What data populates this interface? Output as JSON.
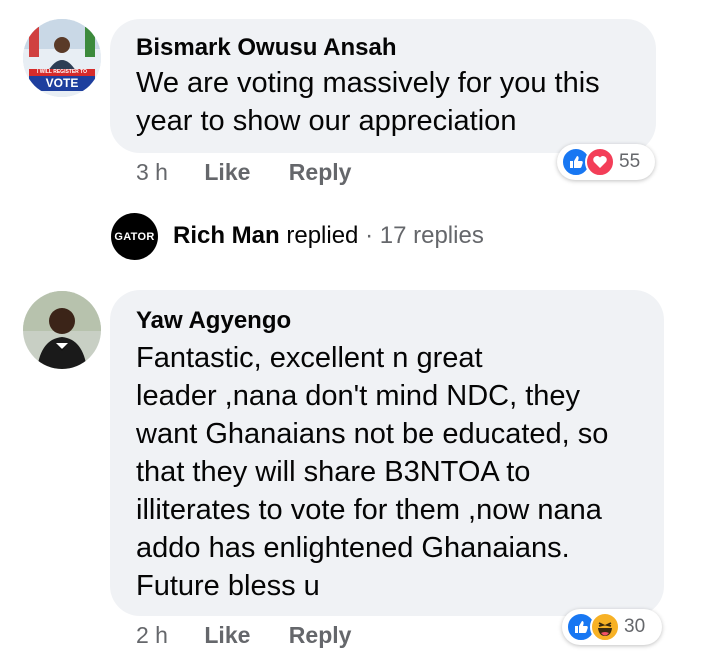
{
  "comment1": {
    "author": "Bismark Owusu Ansah",
    "text_lines": [
      "We are voting massively for you this",
      "year to show our appreciation"
    ],
    "time": "3 h",
    "like_label": "Like",
    "reply_label": "Reply",
    "reaction_count": "55",
    "reaction_icons": [
      "like-icon",
      "love-icon"
    ],
    "avatar_badge_small": "I WILL REGISTER TO",
    "avatar_badge_big": "VOTE"
  },
  "reply_thread": {
    "avatar_text": "GATOR",
    "name": "Rich Man",
    "verb": "replied",
    "separator": "·",
    "count": "17 replies"
  },
  "comment2": {
    "author": "Yaw Agyengo",
    "text_lines": [
      "Fantastic, excellent n great",
      "leader ,nana don't mind NDC, they",
      "want Ghanaians not be educated, so",
      "that they will share B3NTOA to",
      "illiterates to vote for them ,now nana",
      "addo has enlightened Ghanaians.",
      "Future bless u"
    ],
    "time": "2 h",
    "like_label": "Like",
    "reply_label": "Reply",
    "reaction_count": "30",
    "reaction_icons": [
      "like-icon",
      "haha-icon"
    ]
  },
  "colors": {
    "bubble": "#f0f2f5",
    "like_blue": "#1877f2",
    "love_red": "#f33e58",
    "haha_yellow": "#f7b125",
    "meta_gray": "#65676b"
  }
}
